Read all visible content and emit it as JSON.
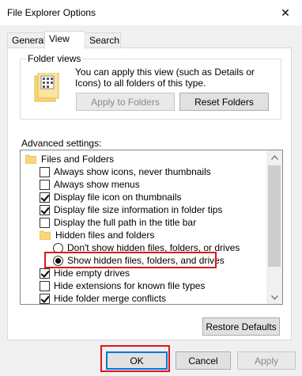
{
  "window": {
    "title": "File Explorer Options",
    "close_glyph": "✕"
  },
  "tabs": [
    {
      "label": "General"
    },
    {
      "label": "View"
    },
    {
      "label": "Search"
    }
  ],
  "folder_views": {
    "title": "Folder views",
    "description": "You can apply this view (such as Details or Icons) to all folders of this type.",
    "apply_button": "Apply to Folders",
    "reset_button": "Reset Folders"
  },
  "advanced": {
    "label": "Advanced settings:",
    "items": [
      {
        "label": "Files and Folders",
        "kind": "folder"
      },
      {
        "label": "Always show icons, never thumbnails",
        "kind": "checkbox",
        "checked": false
      },
      {
        "label": "Always show menus",
        "kind": "checkbox",
        "checked": false
      },
      {
        "label": "Display file icon on thumbnails",
        "kind": "checkbox",
        "checked": true
      },
      {
        "label": "Display file size information in folder tips",
        "kind": "checkbox",
        "checked": true
      },
      {
        "label": "Display the full path in the title bar",
        "kind": "checkbox",
        "checked": false
      },
      {
        "label": "Hidden files and folders",
        "kind": "folder"
      },
      {
        "label": "Don't show hidden files, folders, or drives",
        "kind": "radio",
        "checked": false
      },
      {
        "label": "Show hidden files, folders, and drives",
        "kind": "radio",
        "checked": true
      },
      {
        "label": "Hide empty drives",
        "kind": "checkbox",
        "checked": true
      },
      {
        "label": "Hide extensions for known file types",
        "kind": "checkbox",
        "checked": false
      },
      {
        "label": "Hide folder merge conflicts",
        "kind": "checkbox",
        "checked": true
      }
    ]
  },
  "buttons": {
    "restore_defaults": "Restore Defaults",
    "ok": "OK",
    "cancel": "Cancel",
    "apply": "Apply"
  },
  "colors": {
    "highlight": "#e0141e",
    "focus": "#0078d7",
    "folder": "#f8d775"
  }
}
